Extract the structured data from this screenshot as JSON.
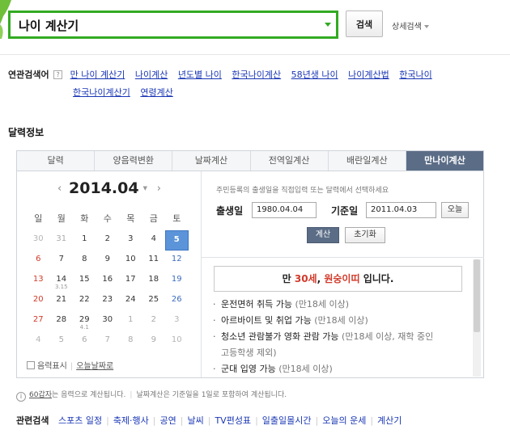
{
  "search": {
    "query": "나이 계산기",
    "button": "검색",
    "advanced": "상세검색"
  },
  "related": {
    "title": "연관검색어",
    "help_icon": "?",
    "items": [
      "만 나이 계산기",
      "나이계산",
      "년도별 나이",
      "한국나이계산",
      "58년생 나이",
      "나이계산법",
      "한국나이",
      "한국나이계산기",
      "연령계산"
    ]
  },
  "section": {
    "title": "달력정보"
  },
  "tabs": [
    "달력",
    "양음력변환",
    "날짜계산",
    "전역일계산",
    "배란일계산",
    "만나이계산"
  ],
  "calendar": {
    "month": "2014.04",
    "prev": "‹",
    "next": "›",
    "weekdays": [
      "일",
      "월",
      "화",
      "수",
      "목",
      "금",
      "토"
    ],
    "weeks": [
      [
        {
          "d": "30",
          "m": true
        },
        {
          "d": "31",
          "m": true
        },
        {
          "d": "1"
        },
        {
          "d": "2"
        },
        {
          "d": "3"
        },
        {
          "d": "4"
        },
        {
          "d": "5",
          "today": true
        }
      ],
      [
        {
          "d": "6"
        },
        {
          "d": "7"
        },
        {
          "d": "8"
        },
        {
          "d": "9"
        },
        {
          "d": "10"
        },
        {
          "d": "11"
        },
        {
          "d": "12"
        }
      ],
      [
        {
          "d": "13"
        },
        {
          "d": "14",
          "sub": "3.15"
        },
        {
          "d": "15"
        },
        {
          "d": "16"
        },
        {
          "d": "17"
        },
        {
          "d": "18"
        },
        {
          "d": "19"
        }
      ],
      [
        {
          "d": "20"
        },
        {
          "d": "21"
        },
        {
          "d": "22"
        },
        {
          "d": "23"
        },
        {
          "d": "24"
        },
        {
          "d": "25"
        },
        {
          "d": "26"
        }
      ],
      [
        {
          "d": "27"
        },
        {
          "d": "28"
        },
        {
          "d": "29",
          "sub": "4.1"
        },
        {
          "d": "30"
        },
        {
          "d": "1",
          "m": true
        },
        {
          "d": "2",
          "m": true
        },
        {
          "d": "3",
          "m": true
        }
      ],
      [
        {
          "d": "4",
          "m": true
        },
        {
          "d": "5",
          "m": true
        },
        {
          "d": "6",
          "m": true
        },
        {
          "d": "7",
          "m": true
        },
        {
          "d": "8",
          "m": true
        },
        {
          "d": "9",
          "m": true
        },
        {
          "d": "10",
          "m": true
        }
      ]
    ],
    "lunar_toggle": "음력표시",
    "today_link": "오늘날짜로"
  },
  "form": {
    "hint": "주민등록의 출생일을 직접입력 또는 달력에서 선택하세요",
    "birth_label": "출생일",
    "birth_value": "1980.04.04",
    "base_label": "기준일",
    "base_value": "2011.04.03",
    "today_btn": "오늘",
    "calc_btn": "계산",
    "reset_btn": "초기화"
  },
  "result": {
    "prefix": "만 ",
    "age": "30세",
    "mid": ", ",
    "zodiac": "원숭이띠",
    "suffix": " 입니다."
  },
  "benefits": [
    {
      "text": "운전면허 취득 가능",
      "note": " (만18세 이상)"
    },
    {
      "text": "아르바이트 및 취업 가능",
      "note": " (만18세 이상)"
    },
    {
      "text": "청소년 관람불가 영화 관람 가능",
      "note": " (만18세 이상, 재학 중인"
    },
    {
      "text": "",
      "note": "고등학생 제외)"
    },
    {
      "text": "군대 입영 가능",
      "note": " (만18세 이상)"
    }
  ],
  "notice": {
    "link": "60갑자",
    "text1": "는 음력으로 계산됩니다.",
    "text2": "날짜계산은 기준일을 1일로 포함하여 계산됩니다."
  },
  "bottom": {
    "title": "관련검색",
    "items": [
      "스포츠 일정",
      "축제·행사",
      "공연",
      "날씨",
      "TV편성표",
      "일출일몰시간",
      "오늘의 운세",
      "계산기"
    ]
  },
  "colors": {
    "green": "#33aa22",
    "active_tab": "#5b6d86",
    "today": "#5b94d8",
    "link": "#1a37b5",
    "accent_red": "#d13a2a"
  }
}
